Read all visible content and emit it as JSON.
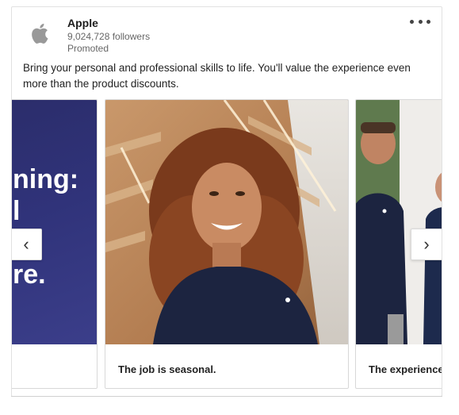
{
  "company": {
    "name": "Apple",
    "followers": "9,024,728 followers",
    "sponsored_label": "Promoted"
  },
  "post": {
    "caption": "Bring your personal and professional skills to life. You'll value the experience even more than the product discounts.",
    "menu_icon": "more-horizontal-icon"
  },
  "carousel": {
    "prev_card": {
      "lines": [
        "ning:",
        "l",
        "re."
      ]
    },
    "cards": [
      {
        "title": "The job is seasonal."
      },
      {
        "title": "The experience"
      }
    ],
    "prev_arrow": "‹",
    "next_arrow": "›"
  },
  "colors": {
    "prev_card_bg": "#2f3278",
    "shirt": "#1c2440",
    "wood": "#b9865a"
  }
}
